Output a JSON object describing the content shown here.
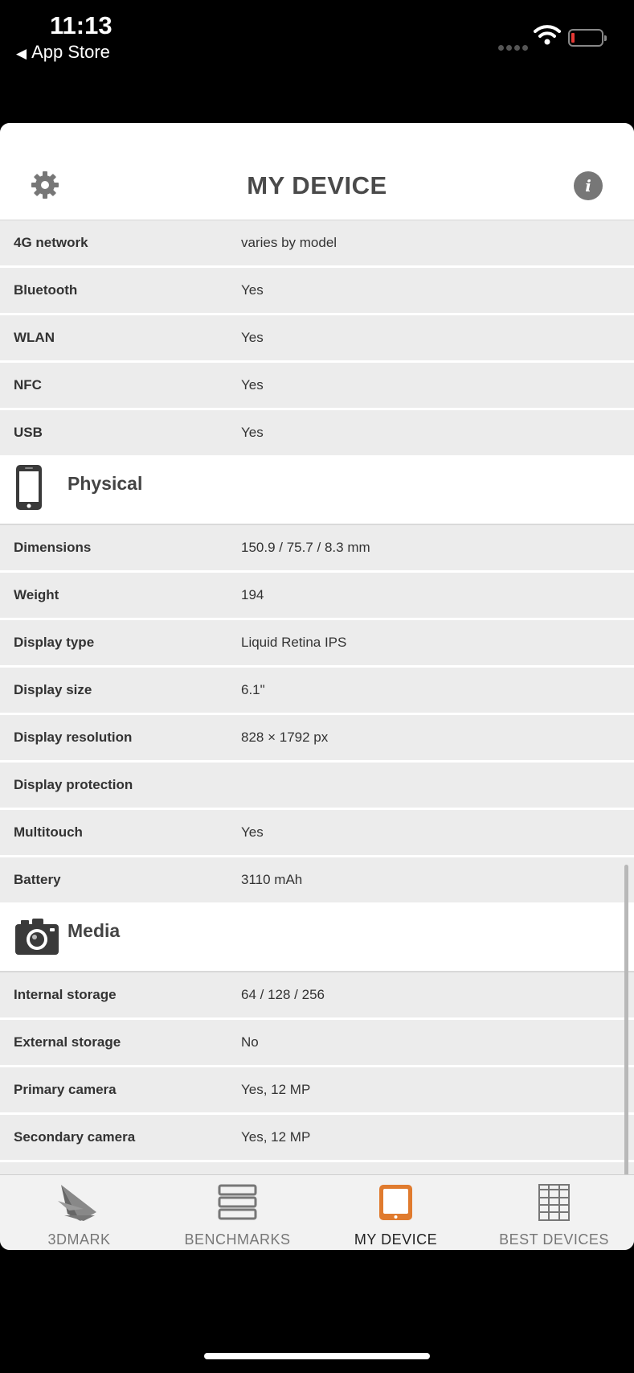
{
  "status": {
    "time": "11:13",
    "back_label": "App Store"
  },
  "header": {
    "title": "MY DEVICE"
  },
  "colors": {
    "accent": "#e07b2e",
    "row_bg": "#ececec"
  },
  "rows_connectivity": [
    {
      "label": "4G network",
      "value": "varies by model"
    },
    {
      "label": "Bluetooth",
      "value": "Yes"
    },
    {
      "label": "WLAN",
      "value": "Yes"
    },
    {
      "label": "NFC",
      "value": "Yes"
    },
    {
      "label": "USB",
      "value": "Yes"
    }
  ],
  "section_physical": {
    "title": "Physical",
    "icon": "phone-icon"
  },
  "rows_physical": [
    {
      "label": "Dimensions",
      "value": "150.9 / 75.7 / 8.3 mm"
    },
    {
      "label": "Weight",
      "value": "194"
    },
    {
      "label": "Display type",
      "value": "Liquid Retina IPS"
    },
    {
      "label": "Display size",
      "value": "6.1\""
    },
    {
      "label": "Display resolution",
      "value": "828 × 1792 px"
    },
    {
      "label": "Display protection",
      "value": ""
    },
    {
      "label": "Multitouch",
      "value": "Yes"
    },
    {
      "label": "Battery",
      "value": "3110 mAh"
    }
  ],
  "section_media": {
    "title": "Media",
    "icon": "camera-icon"
  },
  "rows_media": [
    {
      "label": "Internal storage",
      "value": "64 / 128 / 256"
    },
    {
      "label": "External storage",
      "value": "No"
    },
    {
      "label": "Primary camera",
      "value": "Yes, 12 MP"
    },
    {
      "label": "Secondary camera",
      "value": "Yes, 12 MP"
    }
  ],
  "tabs": [
    {
      "label": "3DMARK",
      "icon": "3dmark-logo-icon"
    },
    {
      "label": "BENCHMARKS",
      "icon": "benchmarks-stack-icon"
    },
    {
      "label": "MY DEVICE",
      "icon": "tablet-icon"
    },
    {
      "label": "BEST DEVICES",
      "icon": "grid-table-icon"
    }
  ]
}
